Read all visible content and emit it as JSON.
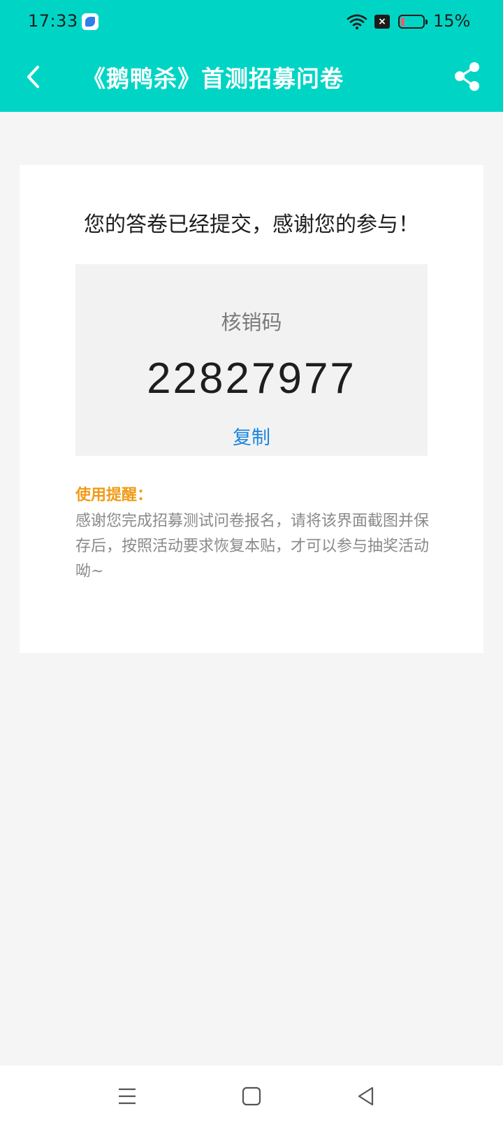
{
  "status_bar": {
    "time": "17:33",
    "battery_percent": "15%",
    "battery_level": 0.15,
    "sim_icon": "sim-off-icon"
  },
  "header": {
    "title": "《鹅鸭杀》首测招募问卷",
    "back_icon": "back-arrow-icon",
    "share_icon": "share-icon"
  },
  "card": {
    "message": "您的答卷已经提交，感谢您的参与！",
    "code_label": "核销码",
    "code_value": "22827977",
    "copy_label": "复制",
    "reminder_title": "使用提醒：",
    "reminder_text": "感谢您完成招募测试问卷报名，请将该界面截图并保存后，按照活动要求恢复本贴，才可以参与抽奖活动呦~"
  },
  "system_nav": {
    "menu_icon": "menu-icon",
    "home_icon": "home-icon",
    "back_icon": "back-triangle-icon"
  },
  "colors": {
    "header_bg": "#00d5c5",
    "copy_link": "#1b86e0",
    "reminder_title": "#f09b17"
  }
}
